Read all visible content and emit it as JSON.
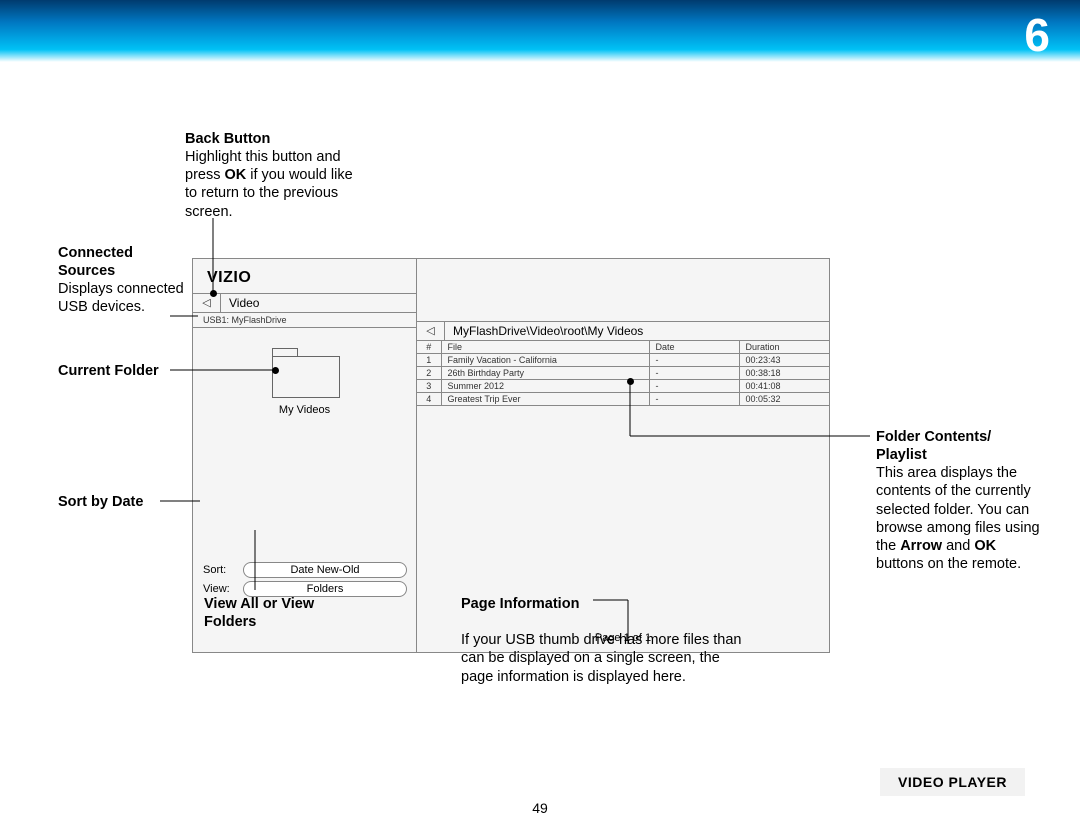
{
  "header": {
    "chapter": "6"
  },
  "page_number": "49",
  "section_title": "VIDEO PLAYER",
  "callouts": {
    "back_button": {
      "title": "Back Button",
      "body_before": "Highlight this button and press ",
      "body_bold1": "OK",
      "body_after": " if you would like to return to the previous screen."
    },
    "connected_sources": {
      "title": "Connected Sources",
      "body": "Displays connected USB devices."
    },
    "current_folder": {
      "title": "Current Folder"
    },
    "sort_by_date": {
      "title": "Sort by Date"
    },
    "view_mode": {
      "title": "View All or View Folders"
    },
    "page_info": {
      "title": "Page Information",
      "body": "If your USB thumb drive has more files than can be displayed on a single screen, the page information is displayed here."
    },
    "folder_contents": {
      "title": "Folder Contents/ Playlist",
      "body_before": "This area displays the contents of the currently selected folder. You can browse among files using the ",
      "bold1": "Arrow",
      "mid1": " and ",
      "bold2": "OK",
      "body_after": " buttons on the remote."
    }
  },
  "panel": {
    "logo": "VIZIO",
    "nav_title": "Video",
    "usb_label": "USB1: MyFlashDrive",
    "folder_name": "My Videos",
    "sort_label": "Sort:",
    "sort_value": "Date New-Old",
    "view_label": "View:",
    "view_value": "Folders",
    "path": "MyFlashDrive\\Video\\root\\My Videos",
    "page_info": "Page 1 of 1",
    "columns": {
      "num": "#",
      "file": "File",
      "date": "Date",
      "duration": "Duration"
    },
    "rows": [
      {
        "num": "1",
        "file": "Family Vacation - California",
        "date": "-",
        "duration": "00:23:43"
      },
      {
        "num": "2",
        "file": "26th Birthday Party",
        "date": "-",
        "duration": "00:38:18"
      },
      {
        "num": "3",
        "file": "Summer 2012",
        "date": "-",
        "duration": "00:41:08"
      },
      {
        "num": "4",
        "file": "Greatest Trip Ever",
        "date": "-",
        "duration": "00:05:32"
      }
    ]
  }
}
